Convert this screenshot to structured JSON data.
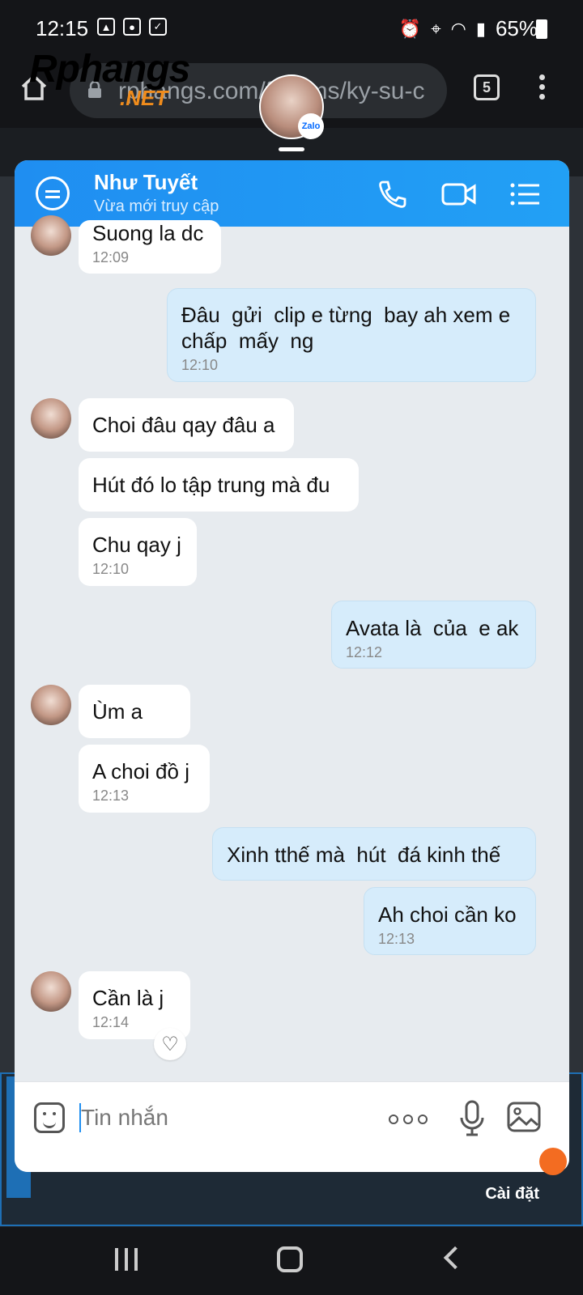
{
  "status_bar": {
    "time": "12:15",
    "battery": "65%"
  },
  "browser": {
    "url": "rphangs.com/forums/ky-su-c",
    "tab_count": "5",
    "site_logo": "Rphangs",
    "site_logo_suffix": ".NET"
  },
  "chat": {
    "contact_name": "Như Tuyết",
    "contact_status": "Vừa mới truy cập",
    "messages": [
      {
        "text": "Suong la dc",
        "time": "12:09"
      },
      {
        "text": "Đâu  gửi  clip e từng  bay ah xem e\nchấp  mấy  ng",
        "time": "12:10"
      },
      {
        "text": "Choi đâu qay đâu a"
      },
      {
        "text": "Hút đó lo tập trung mà đu"
      },
      {
        "text": "Chu qay j",
        "time": "12:10"
      },
      {
        "text": "Avata là  của  e ak",
        "time": "12:12"
      },
      {
        "text": "Ùm a"
      },
      {
        "text": "A choi đồ j",
        "time": "12:13"
      },
      {
        "text": "Xinh tthế mà  hút  đá kinh thế"
      },
      {
        "text": "Ah choi cần ko",
        "time": "12:13"
      },
      {
        "text": "Cần là j",
        "time": "12:14"
      }
    ],
    "input_placeholder": "Tin nhắn"
  },
  "web": {
    "settings_label": "Cài đặt"
  },
  "colors": {
    "header_blue": "#1f8ef1",
    "my_bubble": "#d6ecfb",
    "their_bubble": "#ffffff",
    "chat_bg": "#e7ebef"
  }
}
